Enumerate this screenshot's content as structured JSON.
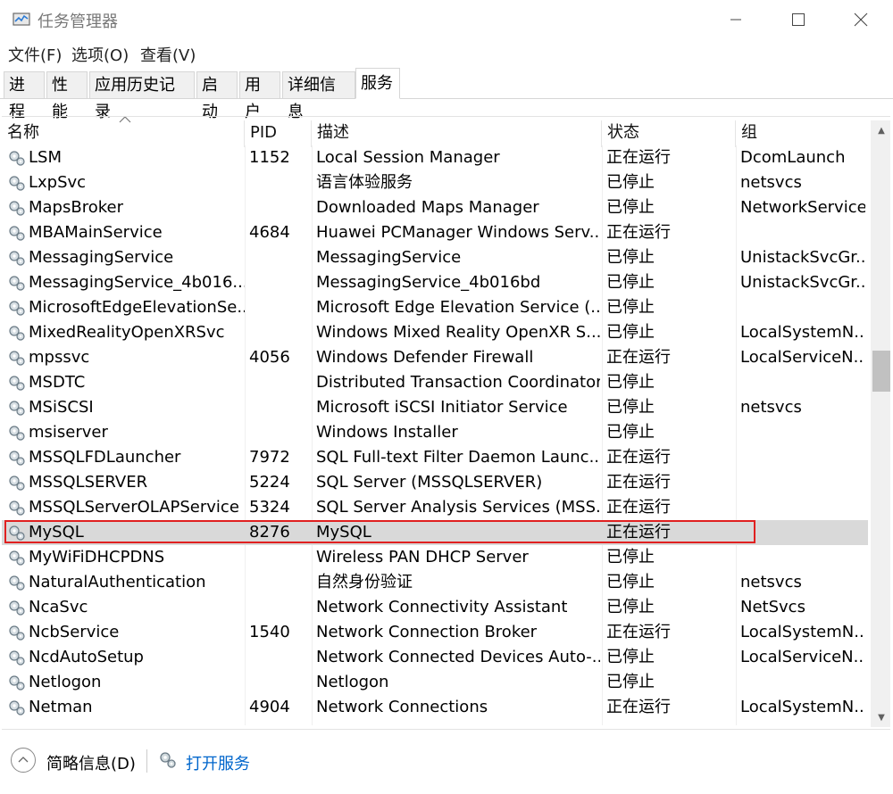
{
  "window": {
    "title": "任务管理器",
    "minimize_icon": "minimize-icon",
    "maximize_icon": "maximize-icon",
    "close_icon": "close-icon"
  },
  "menu": [
    "文件(F)",
    "选项(O)",
    "查看(V)"
  ],
  "tabs": [
    "进程",
    "性能",
    "应用历史记录",
    "启动",
    "用户",
    "详细信息",
    "服务"
  ],
  "active_tab": "服务",
  "columns": {
    "name": "名称",
    "pid": "PID",
    "description": "描述",
    "status": "状态",
    "group": "组"
  },
  "services": [
    {
      "name": "LSM",
      "pid": "1152",
      "description": "Local Session Manager",
      "status": "正在运行",
      "group": "DcomLaunch"
    },
    {
      "name": "LxpSvc",
      "pid": "",
      "description": "语言体验服务",
      "status": "已停止",
      "group": "netsvcs"
    },
    {
      "name": "MapsBroker",
      "pid": "",
      "description": "Downloaded Maps Manager",
      "status": "已停止",
      "group": "NetworkService"
    },
    {
      "name": "MBAMainService",
      "pid": "4684",
      "description": "Huawei PCManager Windows Serv...",
      "status": "正在运行",
      "group": ""
    },
    {
      "name": "MessagingService",
      "pid": "",
      "description": "MessagingService",
      "status": "已停止",
      "group": "UnistackSvcGr..."
    },
    {
      "name": "MessagingService_4b016...",
      "pid": "",
      "description": "MessagingService_4b016bd",
      "status": "已停止",
      "group": "UnistackSvcGr..."
    },
    {
      "name": "MicrosoftEdgeElevationSe...",
      "pid": "",
      "description": "Microsoft Edge Elevation Service (...",
      "status": "已停止",
      "group": ""
    },
    {
      "name": "MixedRealityOpenXRSvc",
      "pid": "",
      "description": "Windows Mixed Reality OpenXR S...",
      "status": "已停止",
      "group": "LocalSystemN..."
    },
    {
      "name": "mpssvc",
      "pid": "4056",
      "description": "Windows Defender Firewall",
      "status": "正在运行",
      "group": "LocalServiceN..."
    },
    {
      "name": "MSDTC",
      "pid": "",
      "description": "Distributed Transaction Coordinator",
      "status": "已停止",
      "group": ""
    },
    {
      "name": "MSiSCSI",
      "pid": "",
      "description": "Microsoft iSCSI Initiator Service",
      "status": "已停止",
      "group": "netsvcs"
    },
    {
      "name": "msiserver",
      "pid": "",
      "description": "Windows Installer",
      "status": "已停止",
      "group": ""
    },
    {
      "name": "MSSQLFDLauncher",
      "pid": "7972",
      "description": "SQL Full-text Filter Daemon Launc...",
      "status": "正在运行",
      "group": ""
    },
    {
      "name": "MSSQLSERVER",
      "pid": "5224",
      "description": "SQL Server (MSSQLSERVER)",
      "status": "正在运行",
      "group": ""
    },
    {
      "name": "MSSQLServerOLAPService",
      "pid": "5324",
      "description": "SQL Server Analysis Services (MSS...",
      "status": "正在运行",
      "group": ""
    },
    {
      "name": "MySQL",
      "pid": "8276",
      "description": "MySQL",
      "status": "正在运行",
      "group": "",
      "selected": true
    },
    {
      "name": "MyWiFiDHCPDNS",
      "pid": "",
      "description": "Wireless PAN DHCP Server",
      "status": "已停止",
      "group": ""
    },
    {
      "name": "NaturalAuthentication",
      "pid": "",
      "description": "自然身份验证",
      "status": "已停止",
      "group": "netsvcs"
    },
    {
      "name": "NcaSvc",
      "pid": "",
      "description": "Network Connectivity Assistant",
      "status": "已停止",
      "group": "NetSvcs"
    },
    {
      "name": "NcbService",
      "pid": "1540",
      "description": "Network Connection Broker",
      "status": "正在运行",
      "group": "LocalSystemN..."
    },
    {
      "name": "NcdAutoSetup",
      "pid": "",
      "description": "Network Connected Devices Auto-...",
      "status": "已停止",
      "group": "LocalServiceN..."
    },
    {
      "name": "Netlogon",
      "pid": "",
      "description": "Netlogon",
      "status": "已停止",
      "group": ""
    },
    {
      "name": "Netman",
      "pid": "4904",
      "description": "Network Connections",
      "status": "正在运行",
      "group": "LocalSystemN..."
    }
  ],
  "footer": {
    "fewer_details": "简略信息(D)",
    "open_services": "打开服务"
  },
  "colors": {
    "selection": "#d9d9d9",
    "highlight_box": "#e02020",
    "link": "#0066cc"
  }
}
